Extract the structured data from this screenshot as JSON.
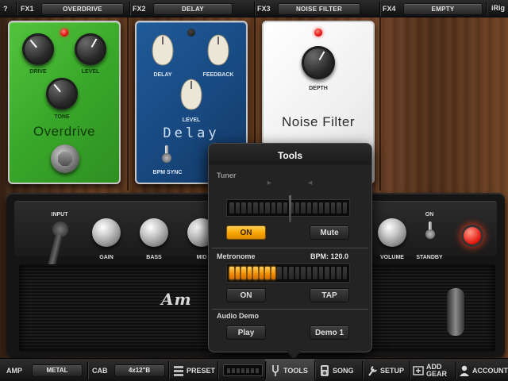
{
  "top_bar": {
    "help_label": "?",
    "slots": [
      {
        "label": "FX1",
        "value": "OVERDRIVE"
      },
      {
        "label": "FX2",
        "value": "DELAY"
      },
      {
        "label": "FX3",
        "value": "NOISE FILTER"
      },
      {
        "label": "FX4",
        "value": "EMPTY"
      }
    ],
    "brand": "iRig"
  },
  "pedals": {
    "overdrive": {
      "name": "Overdrive",
      "knobs": [
        "DRIVE",
        "LEVEL",
        "TONE"
      ],
      "led": "on",
      "color": "#3fb02e"
    },
    "delay": {
      "name": "Delay",
      "knobs": [
        "DELAY",
        "FEEDBACK",
        "LEVEL"
      ],
      "switch_label": "BPM SYNC",
      "led": "off",
      "color": "#1a4f8a"
    },
    "noise_filter": {
      "name": "Noise Filter",
      "knobs": [
        "DEPTH"
      ],
      "led": "on",
      "color": "#f2f2f2"
    }
  },
  "amp": {
    "input_label": "INPUT",
    "knobs": [
      "GAIN",
      "BASS",
      "MID",
      "VOLUME"
    ],
    "standby_label": "STANDBY",
    "standby_state": "ON",
    "logo_text": "Am"
  },
  "tools_popup": {
    "title": "Tools",
    "tuner": {
      "label": "Tuner",
      "on_label": "ON",
      "mute_label": "Mute",
      "on_active": true
    },
    "metronome": {
      "label": "Metronome",
      "bpm_text": "BPM: 120.0",
      "on_label": "ON",
      "tap_label": "TAP",
      "lit_segments": 8,
      "total_segments": 20
    },
    "audio_demo": {
      "label": "Audio Demo",
      "play_label": "Play",
      "demo_label": "Demo 1"
    },
    "accent_color": "#f7a400"
  },
  "bottom_bar": {
    "amp_label": "AMP",
    "amp_value": "METAL",
    "cab_label": "CAB",
    "cab_value": "4x12\"B",
    "preset_label": "PRESET",
    "tools_label": "TOOLS",
    "song_label": "SONG",
    "setup_label": "SETUP",
    "add_gear_label_1": "ADD",
    "add_gear_label_2": "GEAR",
    "account_label": "ACCOUNT",
    "active_tab": "TOOLS"
  }
}
